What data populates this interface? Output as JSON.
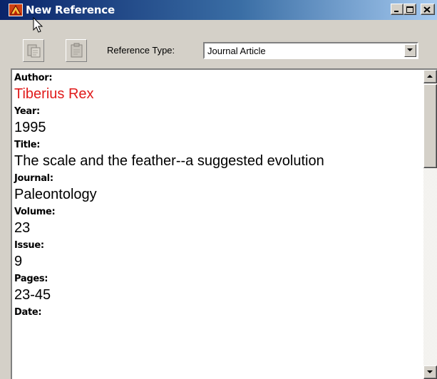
{
  "window": {
    "title": "New Reference",
    "icons": [
      "app-icon",
      "minimize-icon",
      "maximize-icon",
      "close-icon"
    ]
  },
  "toolbar": {
    "buttons": [
      "copy-reference-icon",
      "paste-reference-icon"
    ],
    "reference_type_label": "Reference Type:",
    "reference_type_value": "Journal Article"
  },
  "fields": [
    {
      "label": "Author:",
      "value": "Tiberius Rex",
      "highlight": true
    },
    {
      "label": "Year:",
      "value": "1995"
    },
    {
      "label": "Title:",
      "value": "The scale and the feather--a suggested evolution"
    },
    {
      "label": "Journal:",
      "value": "Paleontology"
    },
    {
      "label": "Volume:",
      "value": "23"
    },
    {
      "label": "Issue:",
      "value": "9"
    },
    {
      "label": "Pages:",
      "value": "23-45"
    },
    {
      "label": "Date:",
      "value": ""
    }
  ],
  "colors": {
    "title_bar_start": "#0a246a",
    "title_bar_end": "#a6caf0",
    "highlight_text": "#e01b1b",
    "window_bg": "#d4d0c8"
  }
}
